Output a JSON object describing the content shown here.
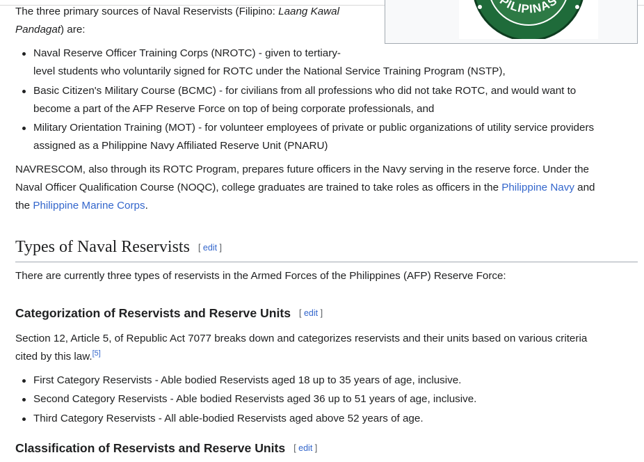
{
  "infobox": {
    "seal_text": "PILIPINAS"
  },
  "intro": {
    "line1_prefix": "The three primary sources of Naval Reservists (Filipino: ",
    "line1_italic": "Laang Kawal",
    "line2_italic": "Pandagat",
    "line2_suffix": ") are:"
  },
  "sources": [
    {
      "line1": "Naval Reserve Officer Training Corps (NROTC) - given to tertiary-",
      "line2": "level students who voluntarily signed for ROTC under the National Service Training Program (NSTP),"
    },
    {
      "line1": "Basic Citizen's Military Course (BCMC) - for civilians from all professions who did not take ROTC, and would want to",
      "line2": "become a part of the AFP Reserve Force on top of being corporate professionals, and"
    },
    {
      "line1": "Military Orientation Training (MOT) - for volunteer employees of private or public organizations of utility service providers",
      "line2": "assigned as a Philippine Navy Affiliated Reserve Unit (PNARU)"
    }
  ],
  "navrescom": {
    "line1": "NAVRESCOM, also through its ROTC Program, prepares future officers in the Navy serving in the reserve force. Under the",
    "line2_text": "Naval Officer Qualification Course (NOQC), college graduates are trained to take roles as officers in the ",
    "line2_link": "Philippine Navy",
    "line2_after": " and",
    "line3_before": "the ",
    "line3_link": "Philippine Marine Corps",
    "line3_after": "."
  },
  "types_section": {
    "heading": "Types of Naval Reservists",
    "edit_open": "[ ",
    "edit_label": "edit",
    "edit_close": " ]",
    "body": "There are currently three types of reservists in the Armed Forces of the Philippines (AFP) Reserve Force:"
  },
  "categorization": {
    "heading": "Categorization of Reservists and Reserve Units",
    "edit_label": "edit",
    "line1": "Section 12, Article 5, of Republic Act 7077 breaks down and categorizes reservists and their units based on various criteria",
    "line2": "cited by this law.",
    "ref": "[5]",
    "items": [
      "First Category Reservists - Able bodied Reservists aged 18 up to 35 years of age, inclusive.",
      "Second Category Reservists - Able bodied Reservists aged 36 up to 51 years of age, inclusive.",
      "Third Category Reservists - All able-bodied Reservists aged above 52 years of age."
    ]
  },
  "classification": {
    "heading": "Classification of Reservists and Reserve Units",
    "edit_label": "edit"
  },
  "colors": {
    "link": "#3366cc",
    "text": "#202122",
    "seal_green": "#1f6b3a"
  }
}
